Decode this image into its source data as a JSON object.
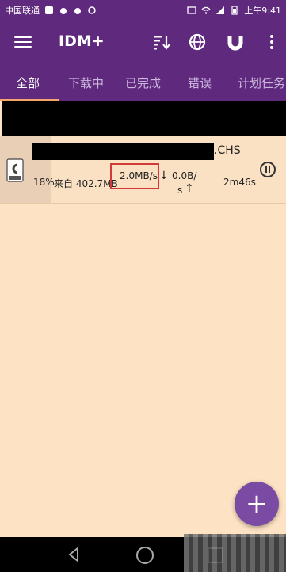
{
  "statusbar": {
    "carrier": "中国联通",
    "time": "上午9:41"
  },
  "appbar": {
    "title": "IDM+",
    "icons": [
      "menu-icon",
      "sort-icon",
      "globe-icon",
      "magnet-icon",
      "more-vert-icon"
    ]
  },
  "tabs": [
    {
      "label": "全部",
      "active": true
    },
    {
      "label": "下载中",
      "active": false
    },
    {
      "label": "已完成",
      "active": false
    },
    {
      "label": "错误",
      "active": false
    },
    {
      "label": "计划任务",
      "active": false
    }
  ],
  "download": {
    "file_suffix": ".CHS",
    "progress": 0.18,
    "percent": "18%",
    "from": "来自 402.7MB",
    "down_speed": "2.0MB/s",
    "up_speed_line1": "0.0B/",
    "up_speed_line2": "s",
    "eta": "2m46s"
  },
  "fab": {
    "label": "+"
  },
  "colors": {
    "primary": "#5f2a7e",
    "accent_fab": "#7b4aa3",
    "background": "#fde2c4",
    "highlight": "#d23a3a"
  }
}
